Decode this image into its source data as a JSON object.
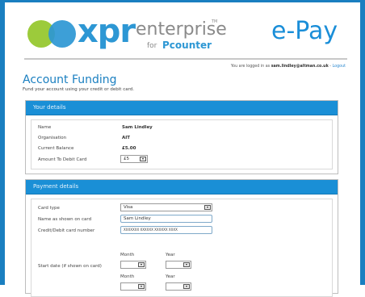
{
  "header": {
    "logo_xpr": "xpr",
    "logo_enterprise": "enterprise",
    "logo_tm": "TM",
    "logo_for": "for",
    "logo_pcounter": "Pcounter",
    "app_title": "e-Pay"
  },
  "login": {
    "prefix": "You are logged in as",
    "user": "sam.lindley@altman.co.uk",
    "separator": " - ",
    "logout": "Logout"
  },
  "page": {
    "title": "Account Funding",
    "subtitle": "Fund your account using your credit or debit card."
  },
  "your_details": {
    "heading": "Your details",
    "name_label": "Name",
    "name_value": "Sam Lindley",
    "org_label": "Organisation",
    "org_value": "AIT",
    "balance_label": "Current Balance",
    "balance_value": "£5.00",
    "amount_label": "Amount To Debit Card",
    "amount_value": "£5"
  },
  "payment_details": {
    "heading": "Payment details",
    "card_type_label": "Card type",
    "card_type_value": "Visa",
    "name_on_card_label": "Name as shown on card",
    "name_on_card_value": "Sam Lindley",
    "card_number_label": "Credit/Debit card number",
    "card_number_value": "XXXXXXX XXXXXX XXXXXX XXXX",
    "start_date_label": "Start date (if shown on card)",
    "month_label": "Month",
    "year_label": "Year",
    "month_label_2": "Month",
    "year_label_2": "Year"
  }
}
